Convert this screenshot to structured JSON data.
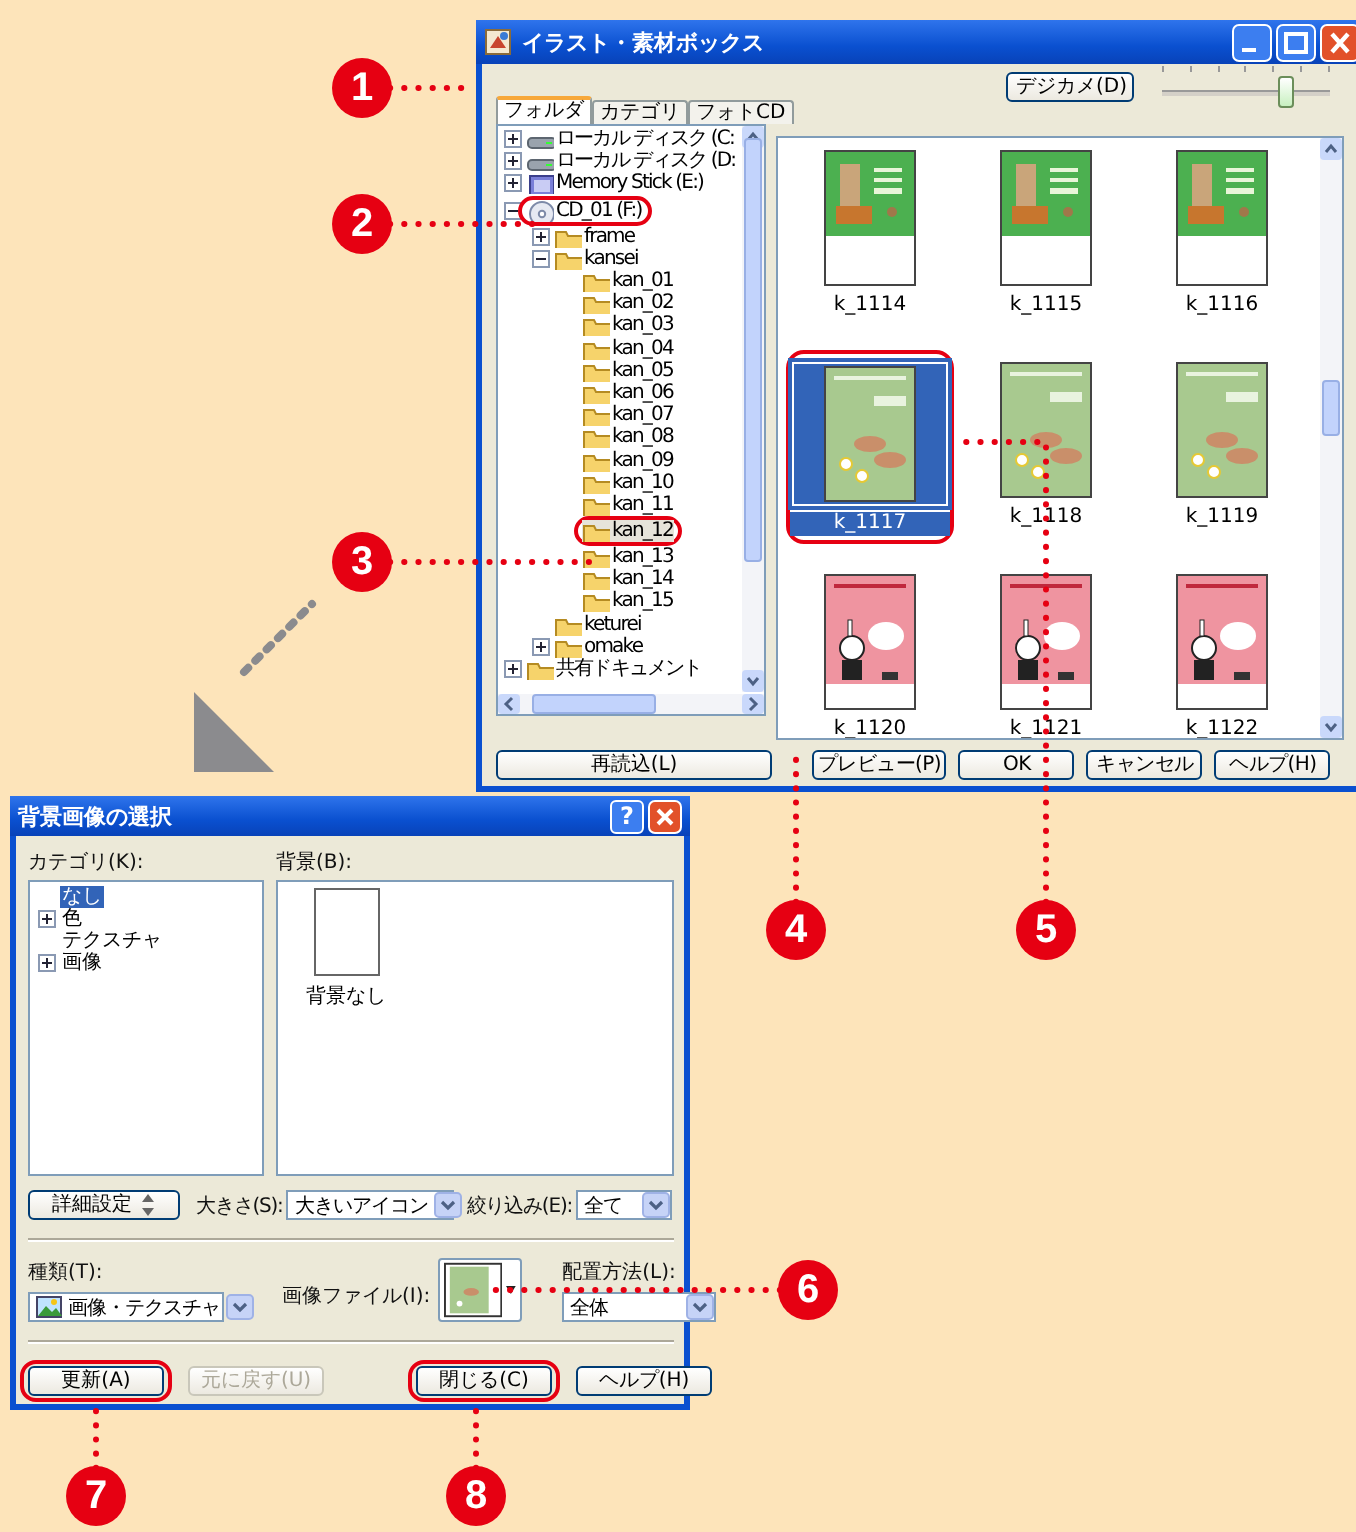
{
  "main_window": {
    "title": "イラスト・素材ボックス",
    "camera_button": "デジカメ(D)",
    "zoom_slider": {
      "level": 0.74
    },
    "tabs": [
      {
        "label": "フォルダ",
        "selected": true
      },
      {
        "label": "カテゴリ",
        "selected": false
      },
      {
        "label": "フォトCD",
        "selected": false
      }
    ],
    "folder_tree": [
      {
        "label": "ローカル ディスク (C:",
        "kind": "drive",
        "expanded": false,
        "selected": false,
        "circled": false
      },
      {
        "label": "ローカル ディスク (D:",
        "kind": "drive",
        "expanded": false,
        "selected": false,
        "circled": false
      },
      {
        "label": "Memory Stick (E:)",
        "kind": "memory",
        "expanded": false,
        "selected": false,
        "circled": false
      },
      {
        "label": "CD_01 (F:)",
        "kind": "cd",
        "expanded": true,
        "selected": false,
        "circled": true,
        "children": [
          {
            "label": "frame",
            "kind": "folder",
            "expanded": false,
            "selected": false,
            "circled": false
          },
          {
            "label": "kansei",
            "kind": "folder",
            "expanded": true,
            "selected": false,
            "circled": false,
            "children": [
              {
                "label": "kan_01",
                "kind": "folder",
                "selected": false,
                "circled": false
              },
              {
                "label": "kan_02",
                "kind": "folder",
                "selected": false,
                "circled": false
              },
              {
                "label": "kan_03",
                "kind": "folder",
                "selected": false,
                "circled": false
              },
              {
                "label": "kan_04",
                "kind": "folder",
                "selected": false,
                "circled": false
              },
              {
                "label": "kan_05",
                "kind": "folder",
                "selected": false,
                "circled": false
              },
              {
                "label": "kan_06",
                "kind": "folder",
                "selected": false,
                "circled": false
              },
              {
                "label": "kan_07",
                "kind": "folder",
                "selected": false,
                "circled": false
              },
              {
                "label": "kan_08",
                "kind": "folder",
                "selected": false,
                "circled": false
              },
              {
                "label": "kan_09",
                "kind": "folder",
                "selected": false,
                "circled": false
              },
              {
                "label": "kan_10",
                "kind": "folder",
                "selected": false,
                "circled": false
              },
              {
                "label": "kan_11",
                "kind": "folder",
                "selected": false,
                "circled": false
              },
              {
                "label": "kan_12",
                "kind": "folder",
                "selected": true,
                "circled": true
              },
              {
                "label": "kan_13",
                "kind": "folder",
                "selected": false,
                "circled": false
              },
              {
                "label": "kan_14",
                "kind": "folder",
                "selected": false,
                "circled": false
              },
              {
                "label": "kan_15",
                "kind": "folder",
                "selected": false,
                "circled": false
              }
            ]
          },
          {
            "label": "keturei",
            "kind": "folder",
            "selected": false,
            "circled": false
          },
          {
            "label": "omake",
            "kind": "folder",
            "expanded": false,
            "selected": false,
            "circled": false
          }
        ]
      },
      {
        "label": "共有ドキュメント",
        "kind": "folder",
        "expanded": false,
        "selected": false,
        "circled": false
      }
    ],
    "thumbnails": [
      {
        "label": "k_1114",
        "kind": "tower",
        "selected": false,
        "circled": false
      },
      {
        "label": "k_1115",
        "kind": "tower",
        "selected": false,
        "circled": false
      },
      {
        "label": "k_1116",
        "kind": "tower",
        "selected": false,
        "circled": false
      },
      {
        "label": "k_1117",
        "kind": "boars",
        "selected": true,
        "circled": true
      },
      {
        "label": "k_1118",
        "kind": "boars",
        "selected": false,
        "circled": false
      },
      {
        "label": "k_1119",
        "kind": "boars",
        "selected": false,
        "circled": false
      },
      {
        "label": "k_1120",
        "kind": "girl",
        "selected": false,
        "circled": false
      },
      {
        "label": "k_1121",
        "kind": "girl",
        "selected": false,
        "circled": false
      },
      {
        "label": "k_1122",
        "kind": "girl",
        "selected": false,
        "circled": false
      }
    ],
    "buttons": [
      {
        "label": "再読込(L)",
        "kind": "reload"
      },
      {
        "label": "プレビュー(P)",
        "kind": "action"
      },
      {
        "label": "OK",
        "kind": "action"
      },
      {
        "label": "キャンセル",
        "kind": "action"
      },
      {
        "label": "ヘルプ(H)",
        "kind": "action"
      }
    ]
  },
  "background_dialog": {
    "title": "背景画像の選択",
    "help_button": "?",
    "category_label": "カテゴリ(K):",
    "categories": [
      {
        "label": "なし",
        "selected": true
      },
      {
        "label": "色",
        "expanded": false,
        "selected": false
      },
      {
        "label": "テクスチャ",
        "selected": false
      },
      {
        "label": "画像",
        "expanded": false,
        "selected": false
      }
    ],
    "background_label": "背景(B):",
    "backgrounds": [
      {
        "label": "背景なし"
      }
    ],
    "detail_button": "詳細設定",
    "size_label": "大きさ(S):",
    "size_value": "大きいアイコン",
    "filter_label": "絞り込み(E):",
    "filter_value": "全て",
    "type_label": "種類(T):",
    "type_value": "画像・テクスチャ",
    "file_label": "画像ファイル(I):",
    "layout_label": "配置方法(L):",
    "layout_value": "全体",
    "buttons": [
      {
        "label": "更新(A)",
        "disabled": false,
        "circled": true
      },
      {
        "label": "元に戻す(U)",
        "disabled": true,
        "circled": false
      },
      {
        "label": "閉じる(C)",
        "disabled": false,
        "circled": true
      },
      {
        "label": "ヘルプ(H)",
        "disabled": false,
        "circled": false
      }
    ]
  },
  "callouts": [
    {
      "number": "1"
    },
    {
      "number": "2"
    },
    {
      "number": "3"
    },
    {
      "number": "4"
    },
    {
      "number": "5"
    },
    {
      "number": "6"
    },
    {
      "number": "7"
    },
    {
      "number": "8"
    }
  ]
}
